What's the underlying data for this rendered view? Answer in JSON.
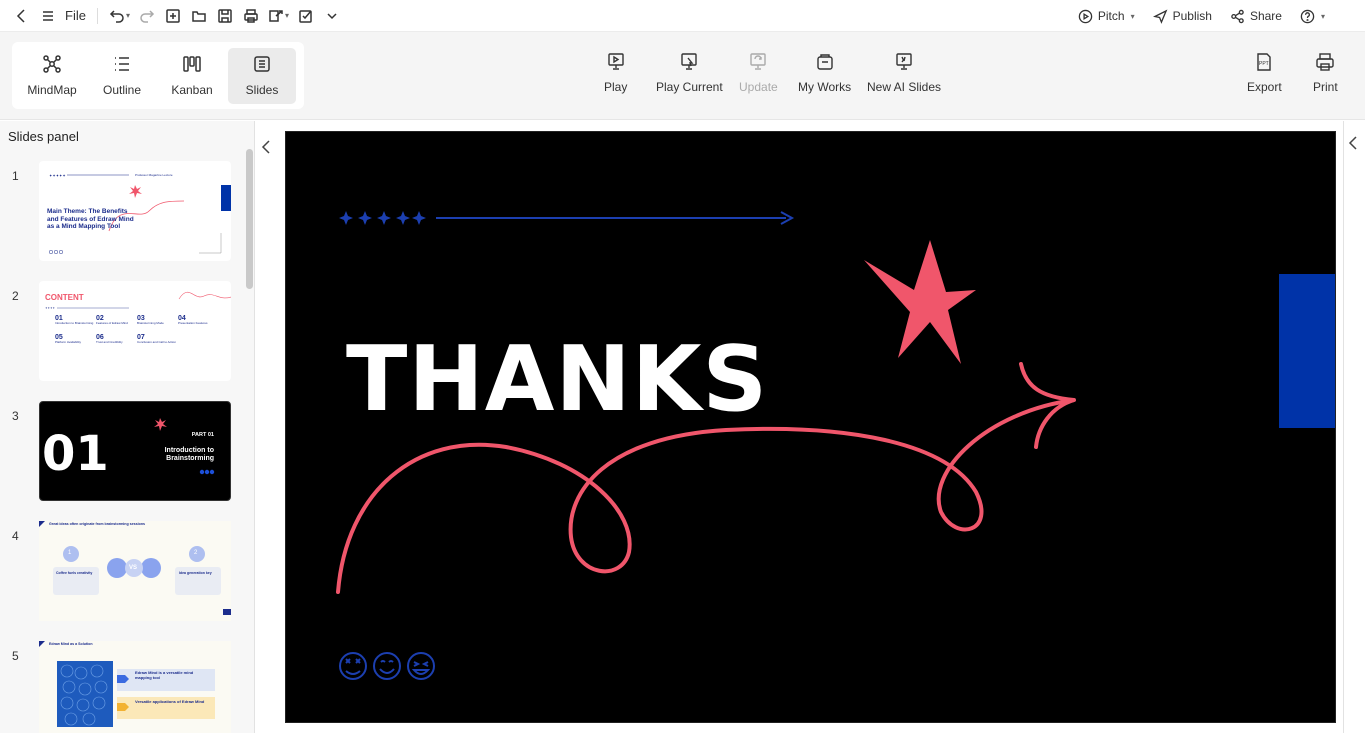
{
  "toolbar": {
    "file_label": "File",
    "pitch_label": "Pitch",
    "publish_label": "Publish",
    "share_label": "Share"
  },
  "views": [
    {
      "label": "MindMap",
      "icon": "mindmap-icon"
    },
    {
      "label": "Outline",
      "icon": "outline-icon"
    },
    {
      "label": "Kanban",
      "icon": "kanban-icon"
    },
    {
      "label": "Slides",
      "icon": "slides-icon",
      "active": true
    }
  ],
  "ribbon_tools": {
    "play": "Play",
    "play_current": "Play Current",
    "update": "Update",
    "my_works": "My Works",
    "new_ai_slides": "New AI Slides",
    "export": "Export",
    "print": "Print"
  },
  "panel": {
    "title": "Slides panel",
    "slides": [
      {
        "number": "1",
        "header": "Professor Magazine Lecture",
        "title": "Main Theme: The Benefits and Features of Edraw Mind as a Mind Mapping Tool"
      },
      {
        "number": "2",
        "title": "CONTENT",
        "items": [
          {
            "num": "01",
            "text": "Introduction to Brainstorming"
          },
          {
            "num": "02",
            "text": "Features of Edraw Mind"
          },
          {
            "num": "03",
            "text": "Brainstorming Mode"
          },
          {
            "num": "04",
            "text": "Presentation Features"
          },
          {
            "num": "05",
            "text": "Platform Availability"
          },
          {
            "num": "06",
            "text": "Trust and Credibility"
          },
          {
            "num": "07",
            "text": "Conclusion and Call to Action"
          }
        ]
      },
      {
        "number": "3",
        "big": "01",
        "part": "PART 01",
        "title": "Introduction to Brainstorming"
      },
      {
        "number": "4",
        "title": "Great ideas often originate from brainstorming sessions",
        "left_label": "Coffee fuels creativity",
        "right_label": "Idea generation key",
        "vs": "VS",
        "n1": "1",
        "n2": "2"
      },
      {
        "number": "5",
        "title": "Edraw Mind as a Solution",
        "card1": "Edraw Mind is a versatile mind mapping tool",
        "card2": "Versatile applications of Edraw Mind"
      }
    ]
  },
  "slide": {
    "heading": "THANKS"
  },
  "colors": {
    "accent_red": "#f0566b",
    "accent_blue": "#0033a8",
    "dark_blue": "#1c2d8c"
  }
}
